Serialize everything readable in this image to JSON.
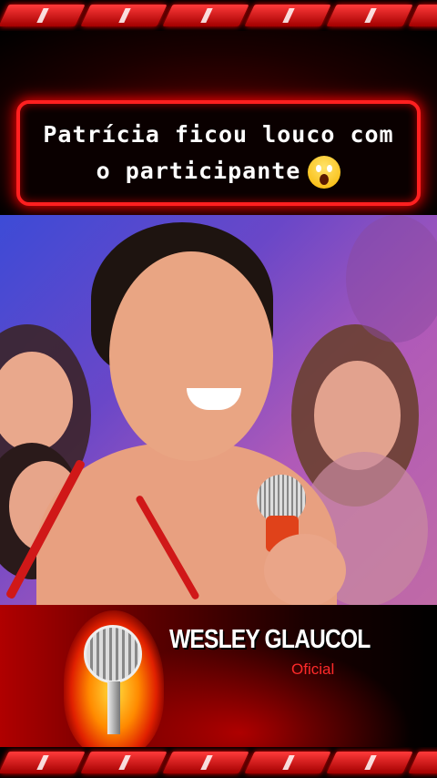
{
  "caption": {
    "line1": "Patrícia ficou louco com",
    "line2": "o participante",
    "emoji": "😱"
  },
  "channel": {
    "name": "WESLEY GLAUCOL",
    "subtitle": "Oficial"
  },
  "icons": {
    "caption_emoji": "scream-face-icon",
    "logo": "microphone-fire-icon"
  },
  "colors": {
    "accent": "#ff2020",
    "background": "#000000",
    "subtitle": "#ff2a2a"
  }
}
